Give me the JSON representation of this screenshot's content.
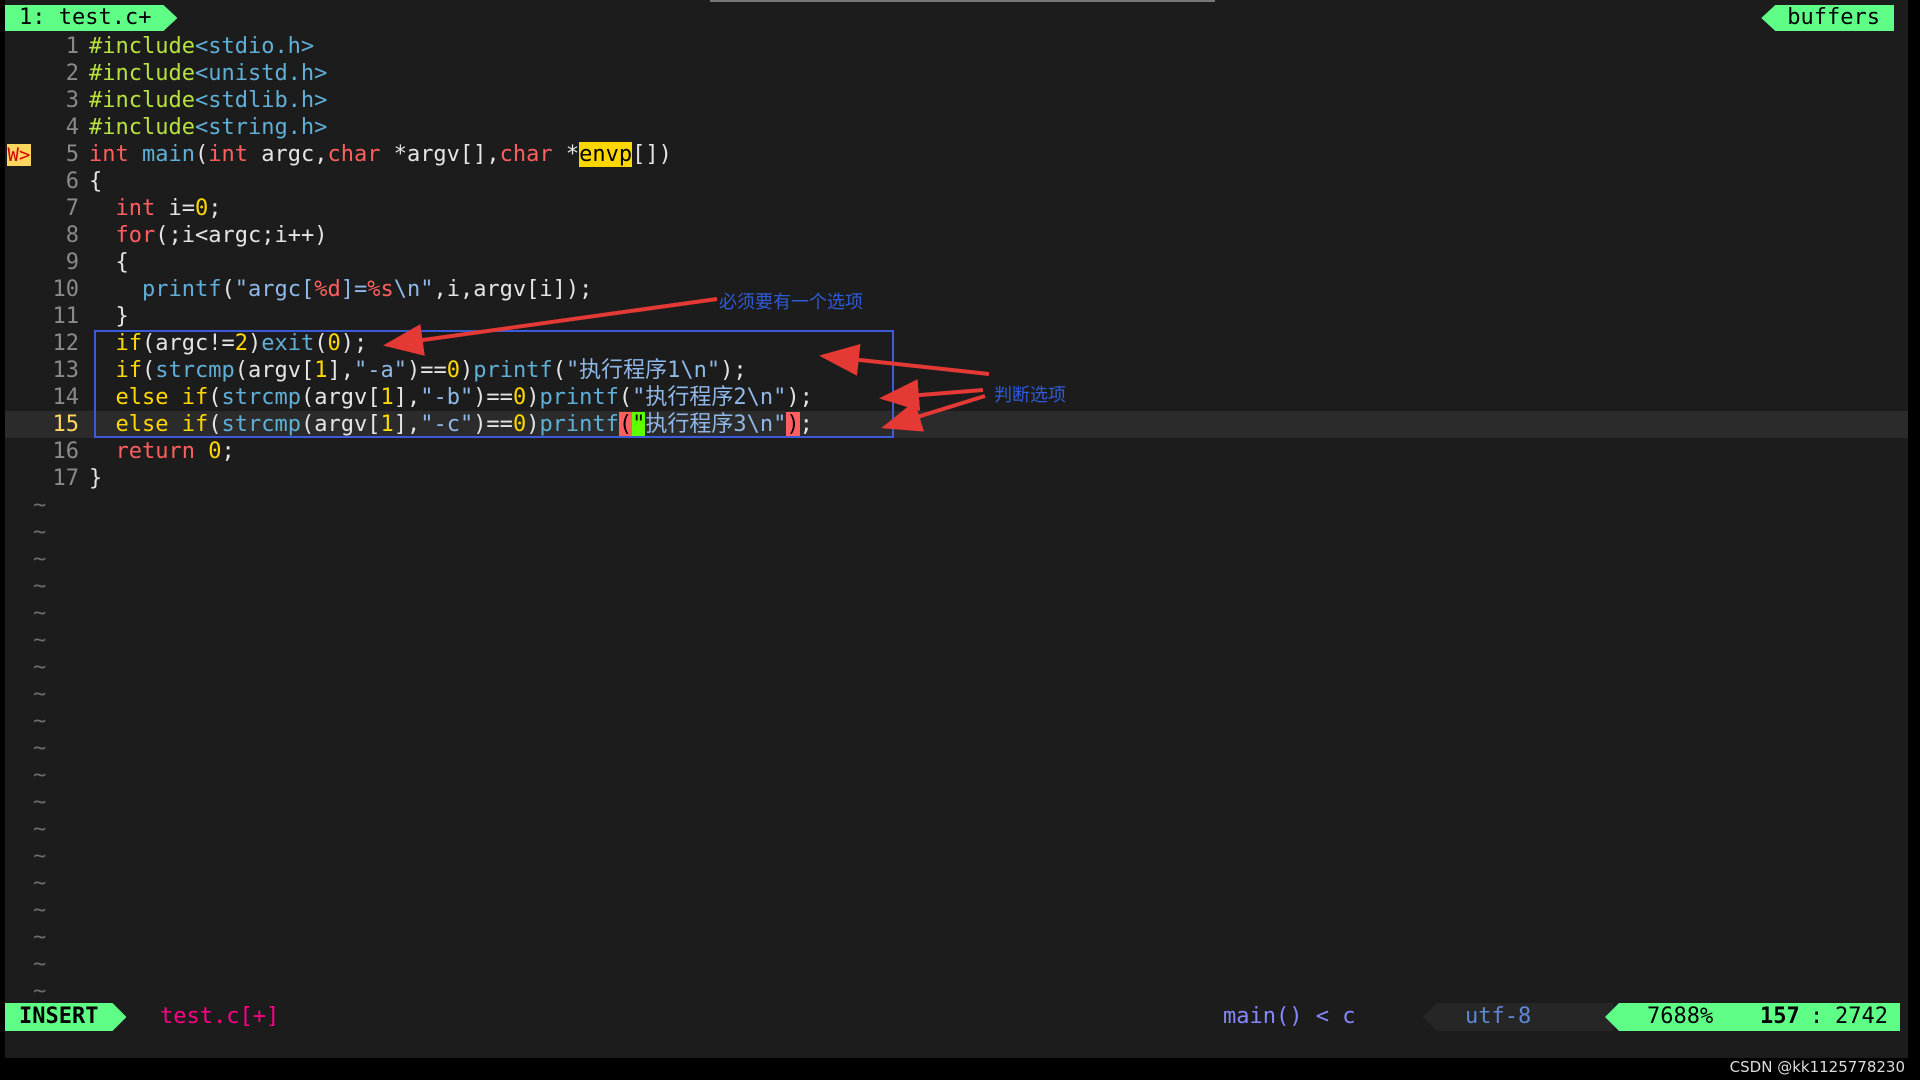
{
  "tabline": {
    "active_tab": "1: test.c+",
    "right_label": "buffers"
  },
  "sign": "W>",
  "lines": [
    {
      "n": "1",
      "segments": [
        {
          "t": "#include",
          "c": "pp"
        },
        {
          "t": "<stdio.h>",
          "c": "hd"
        }
      ]
    },
    {
      "n": "2",
      "segments": [
        {
          "t": "#include",
          "c": "pp"
        },
        {
          "t": "<unistd.h>",
          "c": "hd"
        }
      ]
    },
    {
      "n": "3",
      "segments": [
        {
          "t": "#include",
          "c": "pp"
        },
        {
          "t": "<stdlib.h>",
          "c": "hd"
        }
      ]
    },
    {
      "n": "4",
      "segments": [
        {
          "t": "#include",
          "c": "pp"
        },
        {
          "t": "<string.h>",
          "c": "hd"
        }
      ]
    },
    {
      "n": "5",
      "sign": true,
      "segments": [
        {
          "t": "int",
          "c": "kw"
        },
        {
          "t": " ",
          "c": "pn"
        },
        {
          "t": "main",
          "c": "fn"
        },
        {
          "t": "(",
          "c": "pn"
        },
        {
          "t": "int",
          "c": "kw"
        },
        {
          "t": " argc,",
          "c": "pn"
        },
        {
          "t": "char",
          "c": "kw"
        },
        {
          "t": " *argv[],",
          "c": "pn"
        },
        {
          "t": "char",
          "c": "kw"
        },
        {
          "t": " *",
          "c": "pn"
        },
        {
          "t": "envp",
          "c": "hl-yellow"
        },
        {
          "t": "[])",
          "c": "pn"
        }
      ]
    },
    {
      "n": "6",
      "segments": [
        {
          "t": "{",
          "c": "pn"
        }
      ]
    },
    {
      "n": "7",
      "segments": [
        {
          "t": "  ",
          "c": "pn"
        },
        {
          "t": "int",
          "c": "kw"
        },
        {
          "t": " i=",
          "c": "pn"
        },
        {
          "t": "0",
          "c": "nm"
        },
        {
          "t": ";",
          "c": "pn"
        }
      ]
    },
    {
      "n": "8",
      "segments": [
        {
          "t": "  ",
          "c": "pn"
        },
        {
          "t": "for",
          "c": "kw"
        },
        {
          "t": "(;i<argc;i++)",
          "c": "pn"
        }
      ]
    },
    {
      "n": "9",
      "segments": [
        {
          "t": "  {",
          "c": "pn"
        }
      ]
    },
    {
      "n": "10",
      "segments": [
        {
          "t": "    ",
          "c": "pn"
        },
        {
          "t": "printf",
          "c": "fn"
        },
        {
          "t": "(",
          "c": "pn"
        },
        {
          "t": "\"argc[",
          "c": "st"
        },
        {
          "t": "%d",
          "c": "kw"
        },
        {
          "t": "]=",
          "c": "st"
        },
        {
          "t": "%s",
          "c": "kw"
        },
        {
          "t": "\\n\"",
          "c": "st"
        },
        {
          "t": ",i,argv[i]);",
          "c": "pn"
        }
      ]
    },
    {
      "n": "11",
      "segments": [
        {
          "t": "  }",
          "c": "pn"
        }
      ]
    },
    {
      "n": "12",
      "segments": [
        {
          "t": "  ",
          "c": "pn"
        },
        {
          "t": "if",
          "c": "nm"
        },
        {
          "t": "(argc!=",
          "c": "pn"
        },
        {
          "t": "2",
          "c": "nm"
        },
        {
          "t": ")",
          "c": "pn"
        },
        {
          "t": "exit",
          "c": "fn"
        },
        {
          "t": "(",
          "c": "pn"
        },
        {
          "t": "0",
          "c": "nm"
        },
        {
          "t": ");",
          "c": "pn"
        }
      ]
    },
    {
      "n": "13",
      "segments": [
        {
          "t": "  ",
          "c": "pn"
        },
        {
          "t": "if",
          "c": "nm"
        },
        {
          "t": "(",
          "c": "pn"
        },
        {
          "t": "strcmp",
          "c": "fn"
        },
        {
          "t": "(argv[",
          "c": "pn"
        },
        {
          "t": "1",
          "c": "nm"
        },
        {
          "t": "],",
          "c": "pn"
        },
        {
          "t": "\"-a\"",
          "c": "st"
        },
        {
          "t": ")==",
          "c": "pn"
        },
        {
          "t": "0",
          "c": "nm"
        },
        {
          "t": ")",
          "c": "pn"
        },
        {
          "t": "printf",
          "c": "fn"
        },
        {
          "t": "(",
          "c": "pn"
        },
        {
          "t": "\"执行程序1\\n\"",
          "c": "st"
        },
        {
          "t": ");",
          "c": "pn"
        }
      ]
    },
    {
      "n": "14",
      "segments": [
        {
          "t": "  ",
          "c": "pn"
        },
        {
          "t": "else",
          "c": "nm"
        },
        {
          "t": " ",
          "c": "pn"
        },
        {
          "t": "if",
          "c": "nm"
        },
        {
          "t": "(",
          "c": "pn"
        },
        {
          "t": "strcmp",
          "c": "fn"
        },
        {
          "t": "(argv[",
          "c": "pn"
        },
        {
          "t": "1",
          "c": "nm"
        },
        {
          "t": "],",
          "c": "pn"
        },
        {
          "t": "\"-b\"",
          "c": "st"
        },
        {
          "t": ")==",
          "c": "pn"
        },
        {
          "t": "0",
          "c": "nm"
        },
        {
          "t": ")",
          "c": "pn"
        },
        {
          "t": "printf",
          "c": "fn"
        },
        {
          "t": "(",
          "c": "pn"
        },
        {
          "t": "\"执行程序2\\n\"",
          "c": "st"
        },
        {
          "t": ");",
          "c": "pn"
        }
      ]
    },
    {
      "n": "15",
      "current": true,
      "segments": [
        {
          "t": "  ",
          "c": "pn"
        },
        {
          "t": "else",
          "c": "nm"
        },
        {
          "t": " ",
          "c": "pn"
        },
        {
          "t": "if",
          "c": "nm"
        },
        {
          "t": "(",
          "c": "pn"
        },
        {
          "t": "strcmp",
          "c": "fn"
        },
        {
          "t": "(argv[",
          "c": "pn"
        },
        {
          "t": "1",
          "c": "nm"
        },
        {
          "t": "],",
          "c": "pn"
        },
        {
          "t": "\"-c\"",
          "c": "st"
        },
        {
          "t": ")==",
          "c": "pn"
        },
        {
          "t": "0",
          "c": "nm"
        },
        {
          "t": ")",
          "c": "pn"
        },
        {
          "t": "printf",
          "c": "fn"
        },
        {
          "t": "(",
          "c": "hl-red"
        },
        {
          "t": "\"",
          "c": "hl-cursor"
        },
        {
          "t": "执行程序3\\n\"",
          "c": "st"
        },
        {
          "t": ")",
          "c": "hl-red"
        },
        {
          "t": ";",
          "c": "pn"
        }
      ]
    },
    {
      "n": "16",
      "segments": [
        {
          "t": "  ",
          "c": "pn"
        },
        {
          "t": "return",
          "c": "kw"
        },
        {
          "t": " ",
          "c": "pn"
        },
        {
          "t": "0",
          "c": "nm"
        },
        {
          "t": ";",
          "c": "pn"
        }
      ]
    },
    {
      "n": "17",
      "segments": [
        {
          "t": "}",
          "c": "pn"
        }
      ]
    }
  ],
  "tilde_char": "~",
  "tilde_count": 19,
  "annotations": {
    "note1": "必须要有一个选项",
    "note2": "判断选项"
  },
  "status": {
    "mode": "INSERT",
    "filename": "test.c[+]",
    "function": "main()",
    "separator": "<",
    "filetype": "c",
    "encoding": "utf-8",
    "percent": "7688%",
    "line": "157",
    "col_sep": ":",
    "column": "2742"
  },
  "watermark": "CSDN @kk1125778230",
  "colors": {
    "accent": "#5fff87",
    "annotation": "#3b5bdb",
    "arrow": "#e53935"
  }
}
